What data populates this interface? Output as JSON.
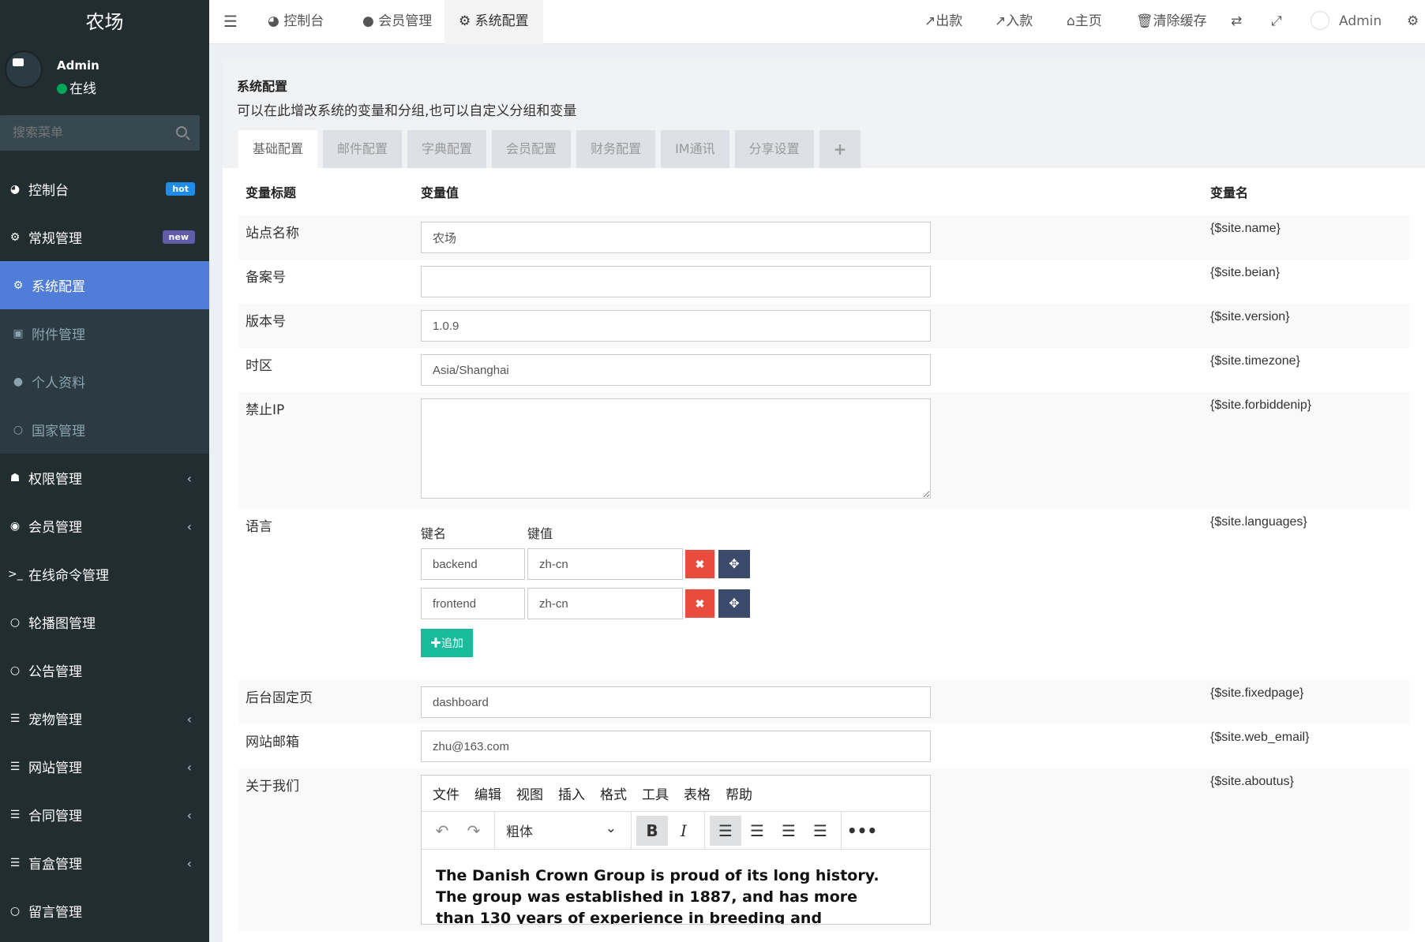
{
  "app": {
    "logo": "农场"
  },
  "user": {
    "name": "Admin",
    "status": "在线"
  },
  "sidebar": {
    "search_placeholder": "搜索菜单",
    "items": [
      {
        "label": "控制台",
        "badge": "hot",
        "badge_color": "#1e8ce8"
      },
      {
        "label": "常规管理",
        "badge": "new",
        "badge_color": "#605ca8"
      },
      {
        "label": "系统配置"
      },
      {
        "label": "附件管理"
      },
      {
        "label": "个人资料"
      },
      {
        "label": "国家管理"
      },
      {
        "label": "权限管理"
      },
      {
        "label": "会员管理"
      },
      {
        "label": "在线命令管理"
      },
      {
        "label": "轮播图管理"
      },
      {
        "label": "公告管理"
      },
      {
        "label": "宠物管理"
      },
      {
        "label": "网站管理"
      },
      {
        "label": "合同管理"
      },
      {
        "label": "盲盒管理"
      },
      {
        "label": "留言管理"
      }
    ]
  },
  "topbar": {
    "tabs": [
      "控制台",
      "会员管理",
      "系统配置"
    ],
    "links": [
      "出款",
      "入款",
      "主页",
      "清除缓存"
    ],
    "user": "Admin"
  },
  "page": {
    "title": "系统配置",
    "subtitle": "可以在此增改系统的变量和分组,也可以自定义分组和变量",
    "tabs": [
      "基础配置",
      "邮件配置",
      "字典配置",
      "会员配置",
      "财务配置",
      "IM通讯",
      "分享设置",
      "+"
    ]
  },
  "table": {
    "headers": [
      "变量标题",
      "变量值",
      "变量名"
    ],
    "rows": {
      "name": {
        "label": "站点名称",
        "value": "农场",
        "var": "{$site.name}"
      },
      "beian": {
        "label": "备案号",
        "value": "",
        "var": "{$site.beian}"
      },
      "version": {
        "label": "版本号",
        "value": "1.0.9",
        "var": "{$site.version}"
      },
      "timezone": {
        "label": "时区",
        "value": "Asia/Shanghai",
        "var": "{$site.timezone}"
      },
      "forbiddenip": {
        "label": "禁止IP",
        "value": "",
        "var": "{$site.forbiddenip}"
      },
      "languages": {
        "label": "语言",
        "var": "{$site.languages}",
        "key_header": "键名",
        "val_header": "键值",
        "pairs": [
          {
            "k": "backend",
            "v": "zh-cn"
          },
          {
            "k": "frontend",
            "v": "zh-cn"
          }
        ],
        "add_label": "追加"
      },
      "fixedpage": {
        "label": "后台固定页",
        "value": "dashboard",
        "var": "{$site.fixedpage}"
      },
      "web_email": {
        "label": "网站邮箱",
        "value": "zhu@163.com",
        "var": "{$site.web_email}"
      },
      "aboutus": {
        "label": "关于我们",
        "var": "{$site.aboutus}"
      }
    }
  },
  "editor": {
    "menu": [
      "文件",
      "编辑",
      "视图",
      "插入",
      "格式",
      "工具",
      "表格",
      "帮助"
    ],
    "format": "粗体",
    "content": "The Danish Crown Group is proud of its long history. The group was established in 1887, and has more than 130 years of experience in breeding and slaughtering. Pork production is the"
  }
}
